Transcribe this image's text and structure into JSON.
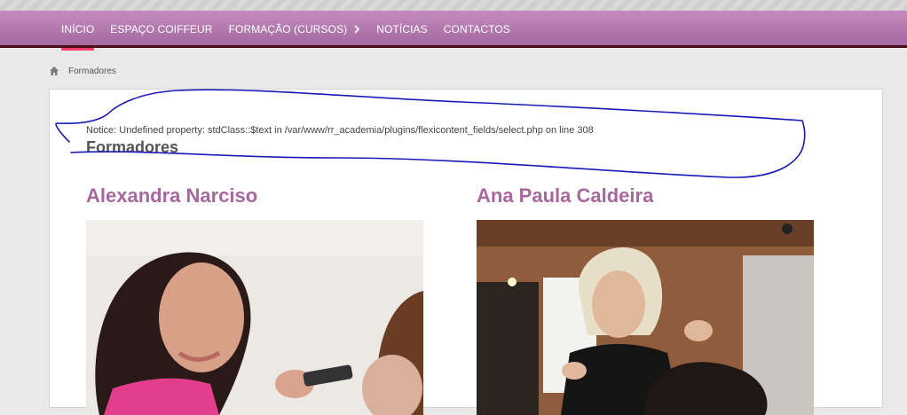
{
  "nav": {
    "items": [
      {
        "label": "INÍCIO",
        "active": true
      },
      {
        "label": "ESPAÇO COIFFEUR"
      },
      {
        "label": "FORMAÇÃO (CURSOS)",
        "has_submenu": true
      },
      {
        "label": "NOTÍCIAS"
      },
      {
        "label": "CONTACTOS"
      }
    ]
  },
  "breadcrumb": {
    "icon": "home-icon",
    "current": "Formadores"
  },
  "notice": "Notice: Undefined property: stdClass::$text in /var/www/rr_academia/plugins/flexicontent_fields/select.php on line 308",
  "page_title": "Formadores",
  "cards": [
    {
      "name": "Alexandra Narciso"
    },
    {
      "name": "Ana Paula Caldeira"
    }
  ],
  "colors": {
    "nav_gradient_top": "#c28bbd",
    "nav_gradient_bottom": "#a56aa0",
    "nav_border": "#4d0c1a",
    "active_underline": "#ff3f6a",
    "name_color": "#a8679f",
    "annotation_ink": "#1a1ab8"
  }
}
